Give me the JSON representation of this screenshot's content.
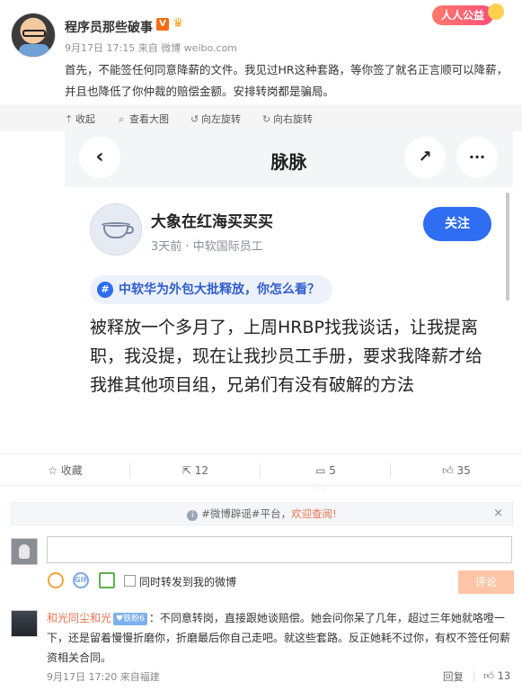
{
  "post": {
    "username": "程序员那些破事",
    "verified_badge": "V",
    "public_welfare_label": "人人公益",
    "meta": "9月17日 17:15 来自 微博 weibo.com",
    "text": "首先，不能签任何同意降薪的文件。我见过HR这种套路，等你签了就名正言顺可以降薪，并且也降低了你仲裁的赔偿金额。安排转岗都是骗局。"
  },
  "image_toolbar": {
    "collapse": "收起",
    "view_large": "查看大图",
    "rotate_left": "向左旋转",
    "rotate_right": "向右旋转"
  },
  "embedded": {
    "back_icon": "‹",
    "app_title": "脉脉",
    "share_icon": "↗",
    "more_icon": "···",
    "author": "大象在红海买买买",
    "author_meta": "3天前 · 中软国际员工",
    "follow_label": "关注",
    "topic_hash": "#",
    "topic": "中软华为外包大批释放，你怎么看？",
    "body": "被释放一个多月了，上周HRBP找我谈话，让我提离职，我没提，现在让我抄员工手册，要求我降薪才给我推其他项目组，兄弟们有没有破解的方法"
  },
  "actions": {
    "favorite_label": "收藏",
    "repost_count": "12",
    "comment_count": "5",
    "like_count": "35"
  },
  "comments": {
    "notice_prefix": "#微博辟谣#平台，",
    "notice_link": "欢迎查阅!",
    "input_placeholder": "",
    "also_repost_label": "同时转发到我的微博",
    "submit_label": "评论",
    "items": [
      {
        "name": "和光同尘和光",
        "badge": "铁粉6",
        "text": "：不同意转岗，直接跟她谈赔偿。她会问你呆了几年，超过三年她就咯噔一下，还是留着慢慢折磨你，折磨最后你自己走吧。就这些套路。反正她耗不过你，有权不签任何薪资相关合同。",
        "meta": "9月17日 17:20 来自福建",
        "reply_label": "回复",
        "likes": "13"
      }
    ]
  }
}
